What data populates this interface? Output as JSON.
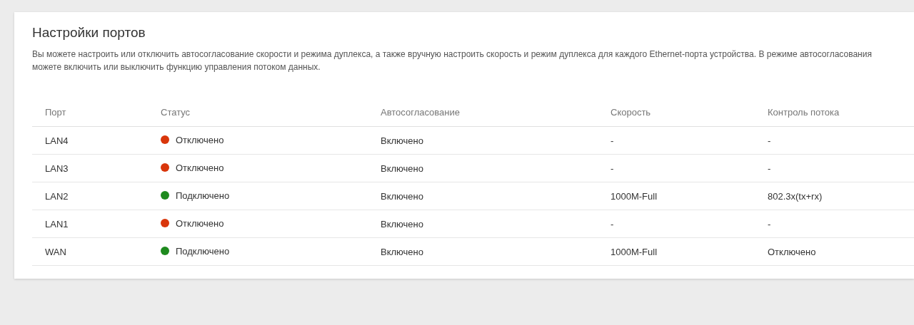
{
  "title": "Настройки портов",
  "description_lines": [
    "Вы можете настроить или отключить автосогласование скорости и режима дуплекса, а также вручную настроить скорость и режим дуплекса для каждого Ethernet-порта устройства. В режиме автосогласования",
    "можете включить или выключить функцию управления потоком данных."
  ],
  "table": {
    "columns": [
      "Порт",
      "Статус",
      "Автосогласование",
      "Скорость",
      "Контроль потока"
    ],
    "rows": [
      {
        "port": "LAN4",
        "status": "Отключено",
        "connected": false,
        "autoneg": "Включено",
        "speed": "-",
        "flow_control": "-"
      },
      {
        "port": "LAN3",
        "status": "Отключено",
        "connected": false,
        "autoneg": "Включено",
        "speed": "-",
        "flow_control": "-"
      },
      {
        "port": "LAN2",
        "status": "Подключено",
        "connected": true,
        "autoneg": "Включено",
        "speed": "1000M-Full",
        "flow_control": "802.3x(tx+rx)"
      },
      {
        "port": "LAN1",
        "status": "Отключено",
        "connected": false,
        "autoneg": "Включено",
        "speed": "-",
        "flow_control": "-"
      },
      {
        "port": "WAN",
        "status": "Подключено",
        "connected": true,
        "autoneg": "Включено",
        "speed": "1000M-Full",
        "flow_control": "Отключено"
      }
    ]
  }
}
